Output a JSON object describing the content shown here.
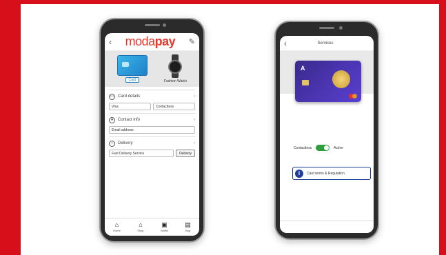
{
  "colors": {
    "brand_red": "#d60f1a",
    "card_blue": "#1e7fc9",
    "toggle_green": "#2e9e3d",
    "info_blue": "#1d3f9a"
  },
  "phone1": {
    "logo": {
      "part1": "moda",
      "part2": "pay"
    },
    "header": {
      "back_icon": "chevron-left-icon",
      "edit_icon": "pencil-icon"
    },
    "products": [
      {
        "label": "Card",
        "icon": "credit-card-icon"
      },
      {
        "label": "Fashion Watch",
        "icon": "watch-icon"
      }
    ],
    "sections": [
      {
        "title": "Card details",
        "icon": "card-icon",
        "fields": [
          "Visa",
          "Contactless"
        ]
      },
      {
        "title": "Contact info",
        "icon": "user-icon",
        "fields": [
          "Email address"
        ]
      },
      {
        "title": "Delivery",
        "icon": "truck-icon",
        "fields": [
          "Fast Delivery Service"
        ],
        "button": "Delivery"
      }
    ],
    "nav": [
      {
        "label": "Home",
        "icon": "home-icon"
      },
      {
        "label": "Shop",
        "icon": "shop-icon"
      },
      {
        "label": "Wallet",
        "icon": "wallet-icon"
      },
      {
        "label": "Bag",
        "icon": "bag-icon"
      }
    ]
  },
  "phone2": {
    "header": {
      "title": "Services",
      "back_icon": "chevron-left-icon"
    },
    "card": {
      "brand": "A",
      "icon": "payment-card-icon"
    },
    "toggle": {
      "left_label": "Contactless",
      "right_label": "Active"
    },
    "info_button": {
      "label": "Card terms & Regulation",
      "icon": "info-icon"
    }
  }
}
